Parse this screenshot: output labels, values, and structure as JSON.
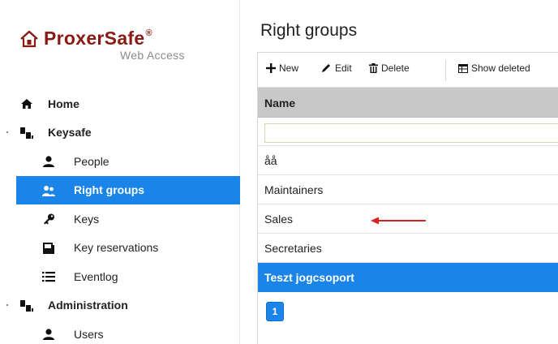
{
  "brand": {
    "name": "ProxerSafe",
    "registered_mark": "®",
    "subtitle": "Web Access",
    "color": "#8a1a14"
  },
  "sidebar": {
    "items": [
      {
        "label": "Home",
        "icon": "home-icon",
        "level": 0,
        "active": false
      },
      {
        "label": "Keysafe",
        "icon": "grid-icon",
        "level": 0,
        "active": false,
        "expandable": true
      },
      {
        "label": "People",
        "icon": "person-icon",
        "level": 1,
        "active": false
      },
      {
        "label": "Right groups",
        "icon": "group-icon",
        "level": 1,
        "active": true
      },
      {
        "label": "Keys",
        "icon": "key-icon",
        "level": 1,
        "active": false
      },
      {
        "label": "Key reservations",
        "icon": "calendar-icon",
        "level": 1,
        "active": false
      },
      {
        "label": "Eventlog",
        "icon": "list-icon",
        "level": 1,
        "active": false
      },
      {
        "label": "Administration",
        "icon": "grid-icon",
        "level": 0,
        "active": false,
        "expandable": true
      },
      {
        "label": "Users",
        "icon": "person-icon",
        "level": 1,
        "active": false
      }
    ]
  },
  "main": {
    "title": "Right groups",
    "toolbar": {
      "new_label": "New",
      "edit_label": "Edit",
      "delete_label": "Delete",
      "show_deleted_label": "Show deleted"
    },
    "table": {
      "columns": [
        "Name"
      ],
      "filter_value": "",
      "rows": [
        {
          "name": "åå",
          "selected": false
        },
        {
          "name": "Maintainers",
          "selected": false
        },
        {
          "name": "Sales",
          "selected": false
        },
        {
          "name": "Secretaries",
          "selected": false
        },
        {
          "name": "Teszt jogcsoport",
          "selected": true
        }
      ]
    },
    "pager": {
      "current_page": "1"
    }
  },
  "colors": {
    "accent": "#1a84e8",
    "header_bg": "#c8c8c8",
    "annotation_arrow": "#d9221c"
  }
}
